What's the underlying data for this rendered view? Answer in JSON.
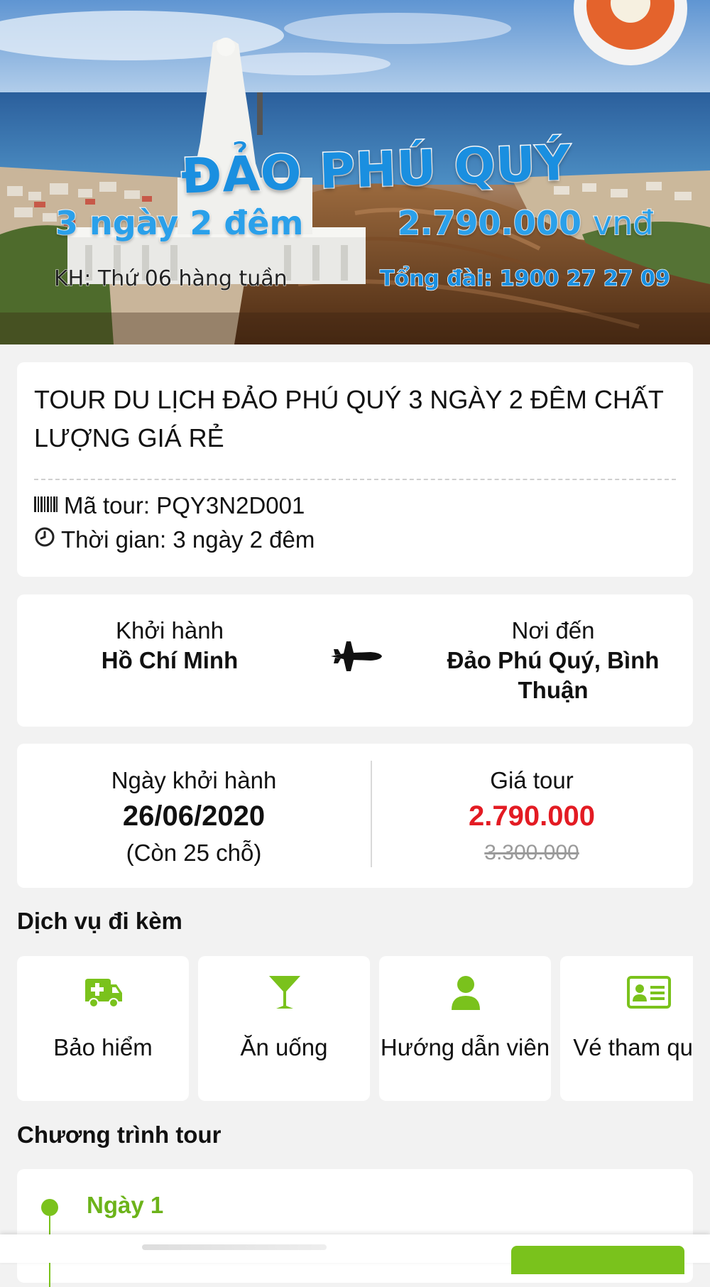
{
  "hero": {
    "title": "ĐẢO PHÚ QUÝ",
    "duration": "3 ngày 2 đêm",
    "price_value": "2.790.000",
    "price_unit": "vnđ",
    "departure_schedule": "KH: Thứ 06 hàng tuần",
    "hotline": "Tổng đài: 1900 27 27 09"
  },
  "tour": {
    "title": "TOUR DU LỊCH ĐẢO PHÚ QUÝ 3 NGÀY 2 ĐÊM CHẤT LƯỢNG GIÁ RẺ",
    "code_text": "Mã tour: PQY3N2D001",
    "time_text": "Thời gian: 3 ngày 2 đêm",
    "code_icon": "barcode-icon",
    "time_icon": "clock-icon"
  },
  "route": {
    "from_label": "Khởi hành",
    "from_value": "Hồ Chí Minh",
    "to_label": "Nơi đến",
    "to_value": "Đảo Phú Quý, Bình Thuận",
    "icon": "airplane-icon"
  },
  "pricing": {
    "date_label": "Ngày khởi hành",
    "date_value": "26/06/2020",
    "seats_text": "(Còn 25 chỗ)",
    "price_label": "Giá tour",
    "price_value": "2.790.000",
    "old_price": "3.300.000"
  },
  "services": {
    "title": "Dịch vụ đi kèm",
    "items": [
      {
        "label": "Bảo hiểm",
        "icon": "ambulance-icon"
      },
      {
        "label": "Ăn uống",
        "icon": "cocktail-icon"
      },
      {
        "label": "Hướng dẫn viên",
        "icon": "user-icon"
      },
      {
        "label": "Vé tham quan",
        "icon": "id-card-icon"
      }
    ]
  },
  "program": {
    "title": "Chương trình tour",
    "days": [
      {
        "label": "Ngày 1"
      }
    ]
  },
  "colors": {
    "accent_green": "#7ac21c",
    "price_red": "#e31b23",
    "hero_blue": "#1a8fe0",
    "old_price_gray": "#9a9a9a"
  }
}
